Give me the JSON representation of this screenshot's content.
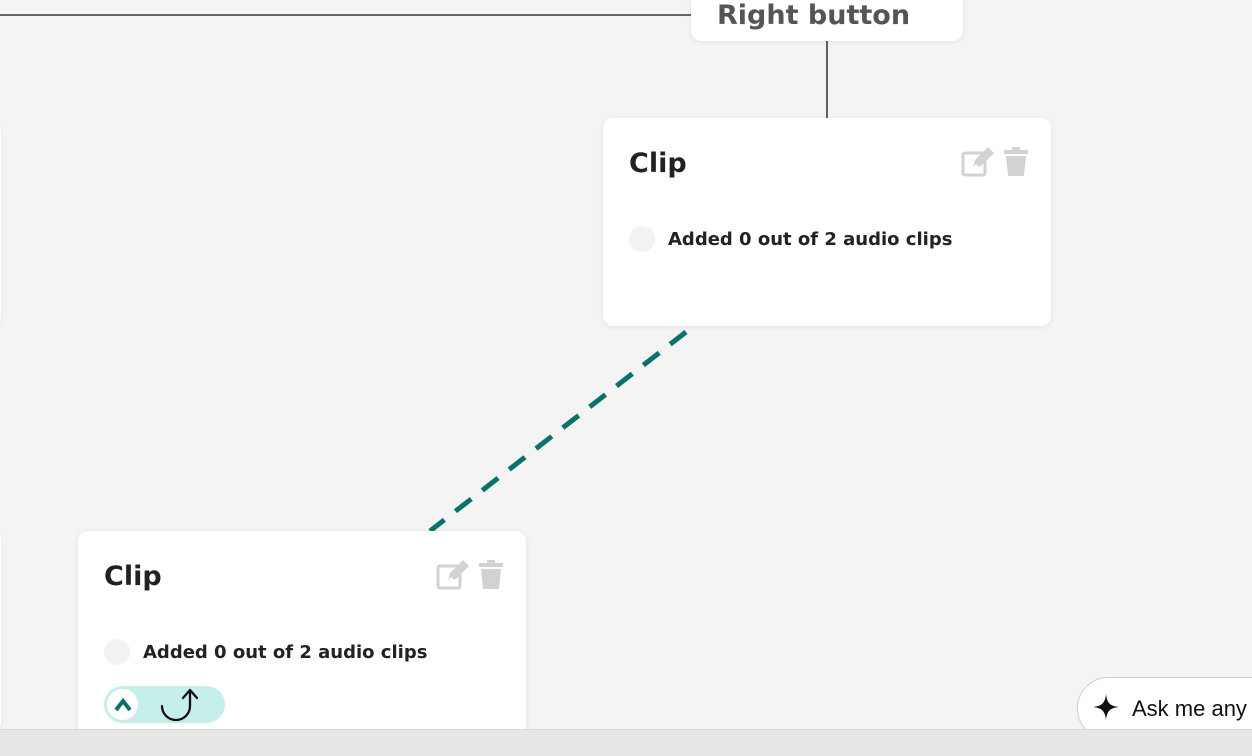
{
  "nodes": {
    "right_button": {
      "label": "Right button"
    },
    "clip_top": {
      "title": "Clip",
      "status": "Added 0 out of 2 audio clips"
    },
    "clip_bottom": {
      "title": "Clip",
      "status": "Added 0 out of 2 audio clips"
    }
  },
  "assistant": {
    "label": "Ask me any"
  },
  "icons": {
    "edit": "edit-icon",
    "trash": "trash-icon",
    "chevron_up": "chevron-up-icon",
    "redo": "redo-icon",
    "sparkle": "sparkle-icon"
  },
  "colors": {
    "canvas_bg": "#f4f4f4",
    "connector_dashed": "#0b716d",
    "connector_solid": "#111111",
    "icon_muted": "#d2d2d2",
    "pill_bg": "#c6efec",
    "accent": "#0b716d"
  }
}
